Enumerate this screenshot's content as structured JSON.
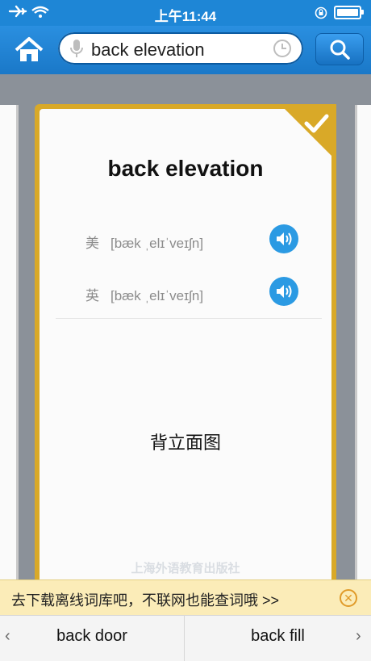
{
  "status_bar": {
    "time": "上午11:44"
  },
  "search": {
    "query": "back elevation"
  },
  "card": {
    "word": "back elevation",
    "phonetics": [
      {
        "label": "美",
        "ipa": "[bæk ˌelɪˈveɪʃn]"
      },
      {
        "label": "英",
        "ipa": "[bæk ˌelɪˈveɪʃn]"
      }
    ],
    "meaning": "背立面图",
    "watermark": "上海外语教育出版社"
  },
  "banner": {
    "text": "去下载离线词库吧，不联网也能查词哦 >>"
  },
  "bottom_nav": {
    "prev_word": "back door",
    "next_word": "back fill",
    "prev_arrow": "‹",
    "next_arrow": "›"
  },
  "colors": {
    "accent": "#1e86d6",
    "card_border": "#d9a928",
    "speaker": "#2b9ae3"
  }
}
